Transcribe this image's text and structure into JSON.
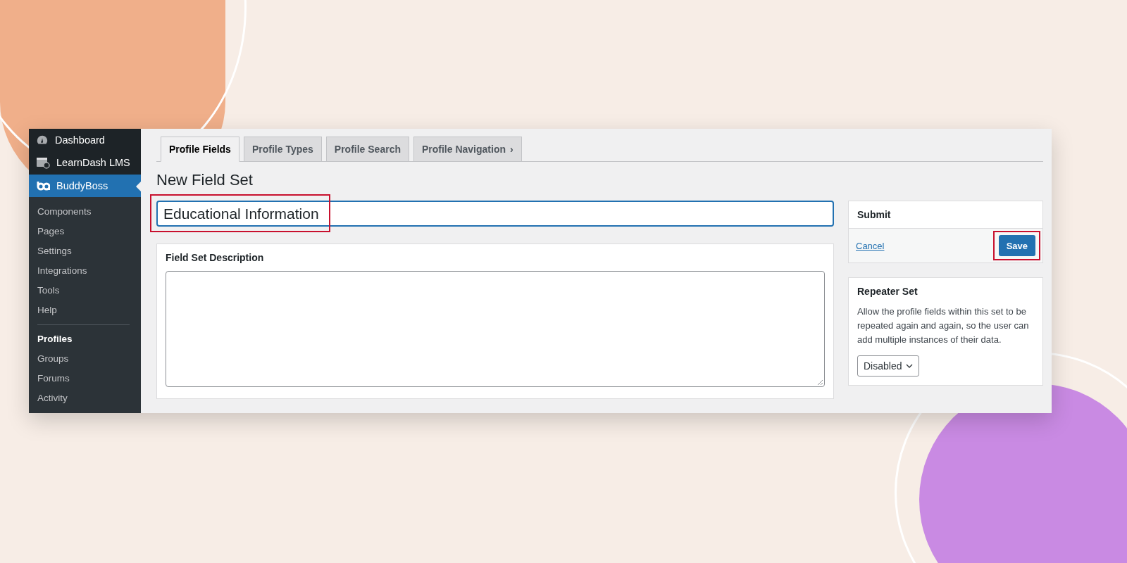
{
  "sidebar": {
    "menu": [
      {
        "label": "Dashboard",
        "kind": "dashboard",
        "selected": false
      },
      {
        "label": "LearnDash LMS",
        "kind": "lms",
        "selected": false
      },
      {
        "label": "BuddyBoss",
        "kind": "brand",
        "selected": true
      }
    ],
    "submenu": [
      {
        "label": "Components",
        "selected": false,
        "divider_after": false
      },
      {
        "label": "Pages",
        "selected": false,
        "divider_after": false
      },
      {
        "label": "Settings",
        "selected": false,
        "divider_after": false
      },
      {
        "label": "Integrations",
        "selected": false,
        "divider_after": false
      },
      {
        "label": "Tools",
        "selected": false,
        "divider_after": false
      },
      {
        "label": "Help",
        "selected": false,
        "divider_after": true
      },
      {
        "label": "Profiles",
        "selected": true,
        "divider_after": false
      },
      {
        "label": "Groups",
        "selected": false,
        "divider_after": false
      },
      {
        "label": "Forums",
        "selected": false,
        "divider_after": false
      },
      {
        "label": "Activity",
        "selected": false,
        "divider_after": false
      }
    ]
  },
  "tabs": [
    {
      "label": "Profile Fields",
      "selected": true
    },
    {
      "label": "Profile Types",
      "selected": false
    },
    {
      "label": "Profile Search",
      "selected": false
    },
    {
      "label": "Profile Navigation",
      "selected": false,
      "chevron": "›"
    }
  ],
  "page_title": "New Field Set",
  "title_field": {
    "value": "Educational Information",
    "highlighted": true
  },
  "description_panel": {
    "title": "Field Set Description"
  },
  "submit_panel": {
    "title": "Submit",
    "cancel": "Cancel",
    "save": "Save",
    "save_highlighted": true
  },
  "repeater_panel": {
    "title": "Repeater Set",
    "text": "Allow the profile fields within this set to be repeated again and again, so the user can add multiple instances of their data.",
    "select": "Disabled"
  }
}
